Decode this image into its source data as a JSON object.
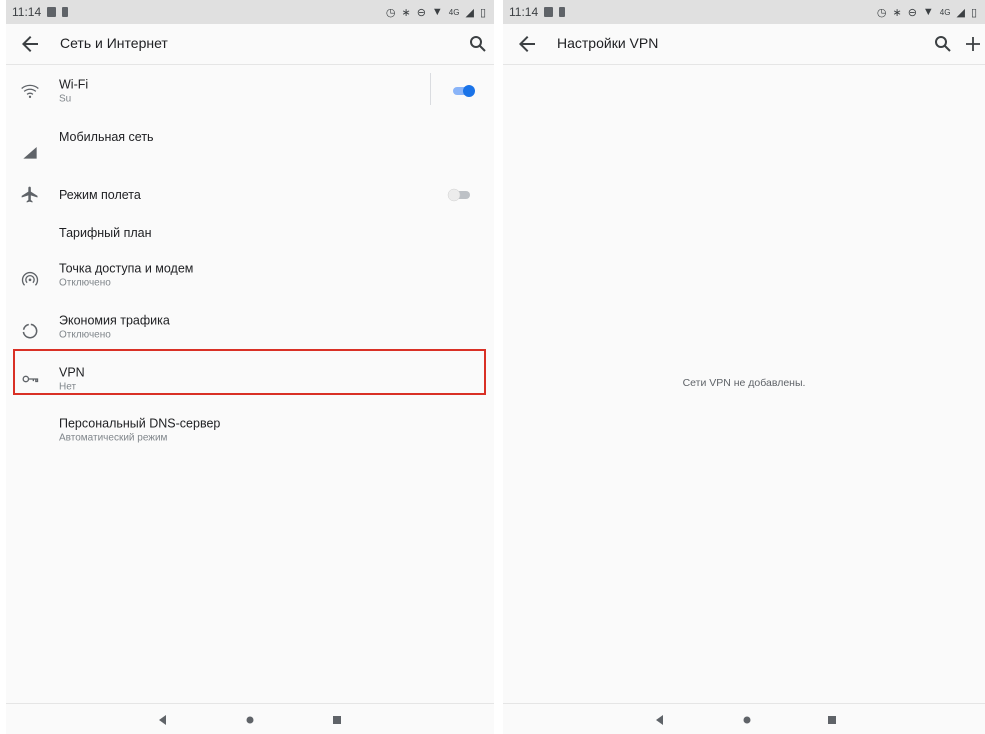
{
  "left": {
    "status": {
      "time": "11:14",
      "network": "4G"
    },
    "appbar": {
      "title": "Сеть и Интернет"
    },
    "items": [
      {
        "title": "Wi-Fi",
        "subtitle": "Su",
        "icon": "wifi-icon",
        "toggle": "on"
      },
      {
        "title": "Мобильная сеть",
        "subtitle": "",
        "icon": "signal-icon"
      },
      {
        "title": "Режим полета",
        "subtitle": "",
        "icon": "airplane-icon",
        "toggle": "off"
      },
      {
        "title": "Тарифный план",
        "subtitle": "",
        "icon": ""
      },
      {
        "title": "Точка доступа и модем",
        "subtitle": "Отключено",
        "icon": "hotspot-icon"
      },
      {
        "title": "Экономия трафика",
        "subtitle": "Отключено",
        "icon": "data-saver-icon"
      },
      {
        "title": "VPN",
        "subtitle": "Нет",
        "icon": "vpn-key-icon",
        "highlighted": true
      },
      {
        "title": "Персональный DNS-сервер",
        "subtitle": "Автоматический режим",
        "icon": ""
      }
    ]
  },
  "right": {
    "status": {
      "time": "11:14",
      "network": "4G"
    },
    "appbar": {
      "title": "Настройки VPN"
    },
    "empty_message": "Сети VPN не добавлены."
  },
  "colors": {
    "accent": "#1a73e8",
    "highlight": "#d93025",
    "background": "#fafafa"
  }
}
